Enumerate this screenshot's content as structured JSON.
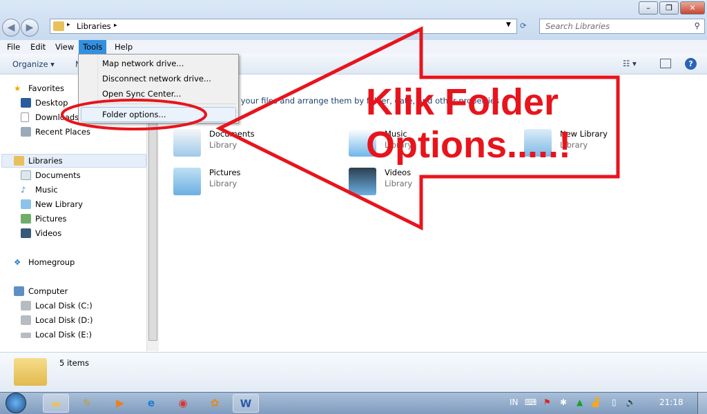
{
  "window": {
    "minimize": "–",
    "maximize": "❐",
    "close": "✕"
  },
  "address": {
    "crumb": "Libraries",
    "sep": "▸"
  },
  "search": {
    "placeholder": "Search Libraries"
  },
  "menubar": [
    "File",
    "Edit",
    "View",
    "Tools",
    "Help"
  ],
  "tools_menu": [
    "Map network drive...",
    "Disconnect network drive...",
    "Open Sync Center...",
    "Folder options..."
  ],
  "toolbar": {
    "organize": "Organize ▾",
    "partial": "N"
  },
  "nav": {
    "favorites": "Favorites",
    "fav_items": [
      "Desktop",
      "Downloads",
      "Recent Places"
    ],
    "libraries": "Libraries",
    "lib_items": [
      "Documents",
      "Music",
      "New Library",
      "Pictures",
      "Videos"
    ],
    "homegroup": "Homegroup",
    "computer": "Computer",
    "comp_items": [
      "Local Disk (C:)",
      "Local Disk (D:)",
      "Local Disk (E:)"
    ]
  },
  "content": {
    "hint": "Open a library to see your files and arrange them by folder, date, and other properties",
    "libraries": [
      {
        "name": "Documents",
        "type": "Library"
      },
      {
        "name": "Music",
        "type": "Library"
      },
      {
        "name": "New Library",
        "type": "Library"
      },
      {
        "name": "Pictures",
        "type": "Library"
      },
      {
        "name": "Videos",
        "type": "Library"
      }
    ]
  },
  "status": {
    "count": "5 items"
  },
  "annotation": {
    "line1": "Klik Folder",
    "line2": "Options.....!",
    "color": "#e8141c"
  },
  "taskbar": {
    "lang": "IN",
    "clock": "21:18"
  }
}
